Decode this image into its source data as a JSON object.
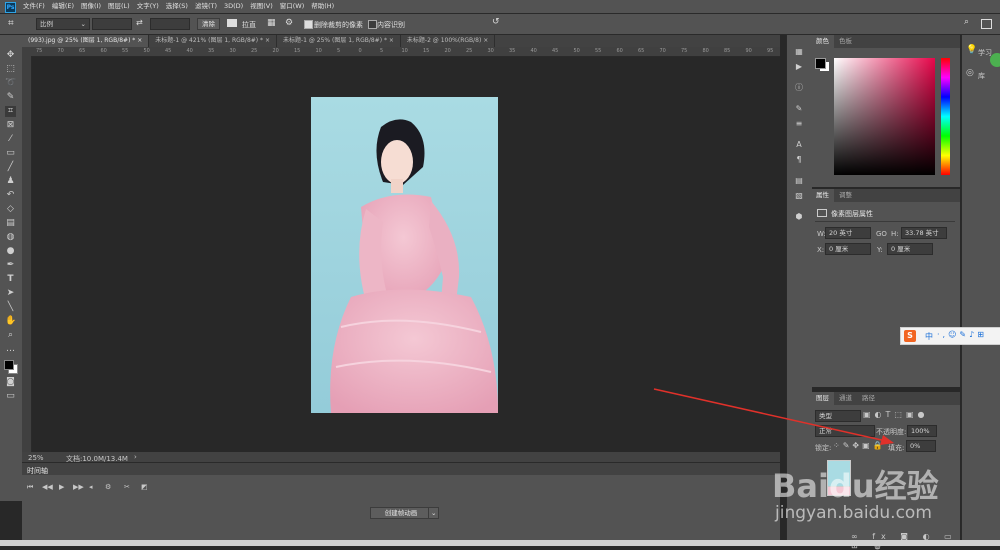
{
  "app": {
    "logo": "Ps"
  },
  "menu": [
    "文件(F)",
    "编辑(E)",
    "图像(I)",
    "图层(L)",
    "文字(Y)",
    "选择(S)",
    "滤镜(T)",
    "3D(D)",
    "视图(V)",
    "窗口(W)",
    "帮助(H)"
  ],
  "options": {
    "ratio_value": "比例",
    "clear_label": "清除",
    "straighten_label": "拉直",
    "delete_cropped_label": "删除裁剪的像素",
    "content_aware_label": "内容识别"
  },
  "tabs": [
    {
      "label": "(993).jpg @ 25% (图层 1, RGB/8#) *",
      "active": true
    },
    {
      "label": "未标题-1 @ 421% (图层 1, RGB/8#) *",
      "active": false
    },
    {
      "label": "未标题-1 @ 25% (图层 1, RGB/8#) *",
      "active": false
    },
    {
      "label": "未标题-2 @ 100%(RGB/8)",
      "active": false
    }
  ],
  "ruler_ticks": [
    "75",
    "70",
    "65",
    "60",
    "55",
    "50",
    "45",
    "40",
    "35",
    "30",
    "25",
    "20",
    "15",
    "10",
    "5",
    "0",
    "5",
    "10",
    "15",
    "20",
    "25",
    "30",
    "35",
    "40",
    "45",
    "50",
    "55",
    "60",
    "65",
    "70",
    "75",
    "80",
    "85",
    "90",
    "95"
  ],
  "status": {
    "zoom": "25%",
    "doc": "文档:10.0M/13.4M"
  },
  "timeline": {
    "tab_label": "时间轴",
    "create_button": "创建帧动画"
  },
  "color_panel": {
    "tabs": [
      "颜色",
      "色板"
    ],
    "hue_color": "#ff003c"
  },
  "properties_panel": {
    "tabs": [
      "属性",
      "调整"
    ],
    "title": "像素图层属性",
    "w_label": "W:",
    "w_value": "20 英寸",
    "go_label": "GO",
    "h_label": "H:",
    "h_value": "33.78 英寸",
    "x_label": "X:",
    "x_value": "0 厘米",
    "y_label": "Y:",
    "y_value": "0 厘米"
  },
  "layers_panel": {
    "tabs": [
      "图层",
      "通道",
      "路径"
    ],
    "kind_value": "类型",
    "blend_value": "正常",
    "opacity_label": "不透明度:",
    "opacity_value": "100%",
    "lock_label": "锁定:",
    "fill_label": "填充:",
    "fill_value": "0%"
  },
  "right_strip": {
    "learn_label": "学习",
    "library_label": "库"
  },
  "ime_bar": {
    "logo": "S",
    "mode": "中"
  },
  "watermark": {
    "brand": "Baidu经验",
    "url": "jingyan.baidu.com"
  }
}
